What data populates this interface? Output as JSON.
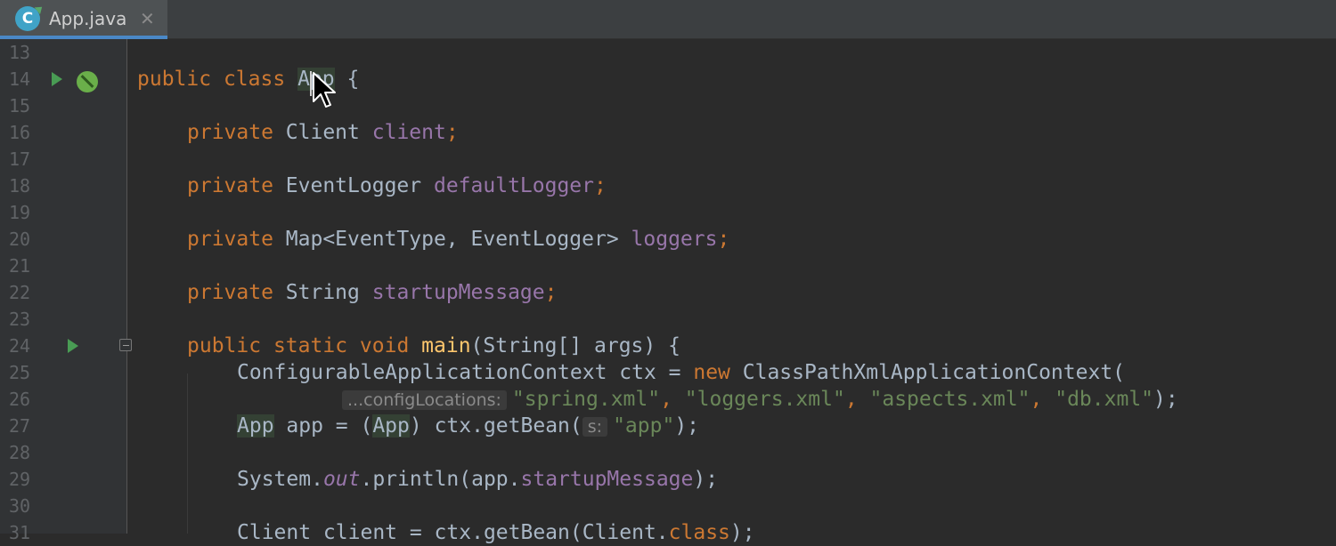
{
  "tab": {
    "label": "App.java",
    "icon_letter": "C",
    "close": "✕"
  },
  "lines": [
    {
      "n": "13",
      "code": ""
    },
    {
      "n": "14",
      "code": "public class App {"
    },
    {
      "n": "15",
      "code": ""
    },
    {
      "n": "16",
      "code": "private Client client;"
    },
    {
      "n": "17",
      "code": ""
    },
    {
      "n": "18",
      "code": "private EventLogger defaultLogger;"
    },
    {
      "n": "19",
      "code": ""
    },
    {
      "n": "20",
      "code": "private Map<EventType, EventLogger> loggers;"
    },
    {
      "n": "21",
      "code": ""
    },
    {
      "n": "22",
      "code": "private String startupMessage;"
    },
    {
      "n": "23",
      "code": ""
    },
    {
      "n": "24",
      "code": "public static void main(String[] args) {"
    },
    {
      "n": "25",
      "code": "ConfigurableApplicationContext ctx = new ClassPathXmlApplicationContext("
    },
    {
      "n": "26",
      "code": "\"spring.xml\", \"loggers.xml\", \"aspects.xml\", \"db.xml\");"
    },
    {
      "n": "27",
      "code": "App app = (App) ctx.getBean(\"app\");"
    },
    {
      "n": "28",
      "code": ""
    },
    {
      "n": "29",
      "code": "System.out.println(app.startupMessage);"
    },
    {
      "n": "30",
      "code": ""
    },
    {
      "n": "31",
      "code": "Client client = ctx.getBean(Client.class);"
    }
  ],
  "hints": {
    "config_locations": "...configLocations:",
    "s": "s:"
  },
  "tokens": {
    "public": "public",
    "class": "class",
    "App": "App",
    "brace_open": " {",
    "private": "private",
    "static": "static",
    "void": "void",
    "new": "new",
    "Client": "Client",
    "client": "client",
    "EventLogger": "EventLogger",
    "defaultLogger": "defaultLogger",
    "map_type": "Map<EventType, EventLogger>",
    "loggers": "loggers",
    "String": "String",
    "startupMessage": "startupMessage",
    "main": "main",
    "main_args": "(String[] args) {",
    "ctx_decl": "ConfigurableApplicationContext ctx = ",
    "ctx_ctor": " ClassPathXmlApplicationContext(",
    "s1": "\"spring.xml\"",
    "s2": "\"loggers.xml\"",
    "s3": "\"aspects.xml\"",
    "s4": "\"db.xml\"",
    "app_var": " app = (",
    "app_cast": ") ctx.getBean(",
    "app_str": "\"app\"",
    "system": "System.",
    "out": "out",
    "println": ".println(app.",
    "close_paren": ");",
    "client_line": "Client client = ctx.getBean(Client.",
    "class_kw": "class",
    "semi": ";",
    "comma": ", "
  },
  "colors": {
    "keyword": "#cc7832",
    "field": "#9876aa",
    "string": "#6a8759",
    "method": "#ffc66d",
    "text": "#a9b7c6",
    "line_number": "#606366"
  }
}
